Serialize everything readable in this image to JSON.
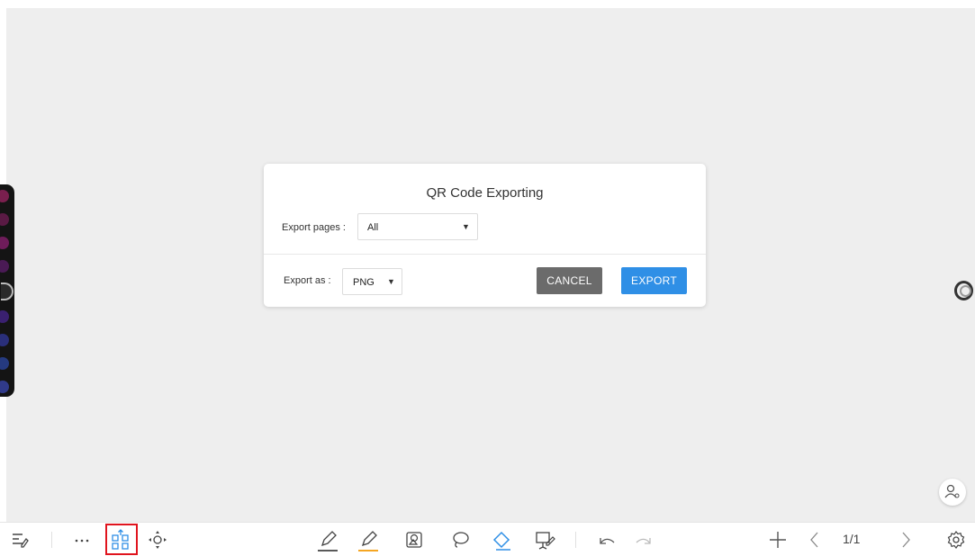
{
  "dialog": {
    "title": "QR Code Exporting",
    "export_pages_label": "Export pages :",
    "export_pages_value": "All",
    "export_as_label": "Export as :",
    "export_as_value": "PNG",
    "cancel_label": "CANCEL",
    "export_label": "EXPORT"
  },
  "toolbar": {
    "page_indicator": "1/1",
    "icons": [
      "menu-icon",
      "more-icon",
      "qr-code-export-icon",
      "move-icon",
      "pen-icon",
      "highlighter-icon",
      "shape-icon",
      "lasso-icon",
      "eraser-icon",
      "presentation-icon",
      "undo-icon",
      "redo-icon",
      "add-page-icon",
      "prev-page-icon",
      "next-page-icon",
      "settings-icon"
    ]
  },
  "colors": {
    "canvas_bg": "#eeeeee",
    "cancel_button": "#6b6b6b",
    "export_button": "#2f8fe6",
    "highlight_box": "#e0141e",
    "highlighter_underline": "#f5a623"
  }
}
